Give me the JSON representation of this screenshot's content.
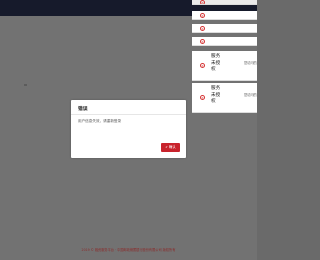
{
  "footer": {
    "text": "2019 © 融资服务平台 · 中国邮政储蓄银行股份有限公司 版权所有"
  },
  "notifications": [
    {
      "title": "",
      "description": ""
    },
    {
      "title": "",
      "description": ""
    },
    {
      "title": "",
      "description": ""
    },
    {
      "title": "",
      "description": ""
    },
    {
      "title": "服务未授权",
      "description": "您访问的服务未授权"
    },
    {
      "title": "服务未授权",
      "description": "您访问的服务未授权"
    }
  ],
  "modal": {
    "title": "错误",
    "message": "用户信息失效，请重新登录",
    "button_label": "确认",
    "button_icon": "check-icon"
  },
  "colors": {
    "topbar": "#161a2b",
    "accent": "#c8232c",
    "error": "#d53535"
  }
}
